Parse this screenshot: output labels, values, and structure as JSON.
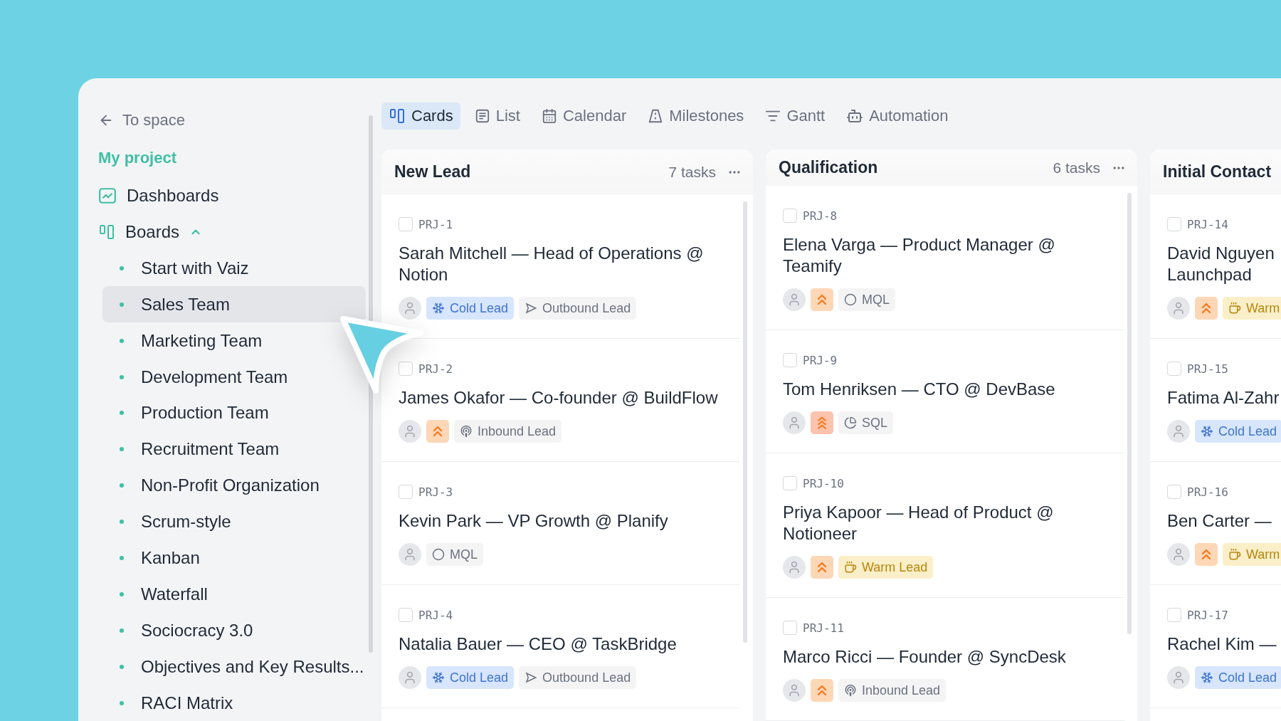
{
  "sidebar": {
    "back": "To space",
    "project": "My project",
    "nav": [
      {
        "kind": "dashboards",
        "label": "Dashboards"
      },
      {
        "kind": "boards",
        "label": "Boards",
        "expanded": true
      }
    ],
    "boards": [
      {
        "label": "Start with Vaiz",
        "selected": false
      },
      {
        "label": "Sales Team",
        "selected": true
      },
      {
        "label": "Marketing Team",
        "selected": false
      },
      {
        "label": "Development Team",
        "selected": false
      },
      {
        "label": "Production Team",
        "selected": false
      },
      {
        "label": "Recruitment Team",
        "selected": false
      },
      {
        "label": "Non-Profit Organization",
        "selected": false
      },
      {
        "label": "Scrum-style",
        "selected": false
      },
      {
        "label": "Kanban",
        "selected": false
      },
      {
        "label": "Waterfall",
        "selected": false
      },
      {
        "label": "Sociocracy 3.0",
        "selected": false
      },
      {
        "label": "Objectives and Key Results...",
        "selected": false
      },
      {
        "label": "RACI Matrix",
        "selected": false
      }
    ]
  },
  "tabs": [
    {
      "kind": "cards",
      "label": "Cards",
      "selected": true
    },
    {
      "kind": "list",
      "label": "List",
      "selected": false
    },
    {
      "kind": "calendar",
      "label": "Calendar",
      "selected": false
    },
    {
      "kind": "milestones",
      "label": "Milestones",
      "selected": false
    },
    {
      "kind": "gantt",
      "label": "Gantt",
      "selected": false
    },
    {
      "kind": "automation",
      "label": "Automation",
      "selected": false
    }
  ],
  "columns": [
    {
      "title": "New Lead",
      "count": "7 tasks",
      "scrollbar": true,
      "cards": [
        {
          "id": "PRJ-1",
          "checked": false,
          "title": "Sarah Mitchell — Head of Operations @ Notion",
          "tags": [
            {
              "kind": "cold",
              "label": "Cold Lead"
            },
            {
              "kind": "outbound",
              "label": "Outbound Lead"
            }
          ]
        },
        {
          "id": "PRJ-2",
          "checked": false,
          "title": "James Okafor — Co-founder @ BuildFlow",
          "priority": true,
          "urgent": false,
          "tags": [
            {
              "kind": "inbound",
              "label": "Inbound Lead"
            }
          ]
        },
        {
          "id": "PRJ-3",
          "checked": false,
          "title": "Kevin Park — VP Growth @ Planify",
          "tags": [
            {
              "kind": "mql",
              "label": "MQL"
            }
          ]
        },
        {
          "id": "PRJ-4",
          "checked": false,
          "title": "Natalia Bauer — CEO @ TaskBridge",
          "tags": [
            {
              "kind": "cold",
              "label": "Cold Lead"
            },
            {
              "kind": "outbound",
              "label": "Outbound Lead"
            }
          ]
        }
      ]
    },
    {
      "title": "Qualification",
      "count": "6 tasks",
      "scrollbar": true,
      "cards": [
        {
          "id": "PRJ-8",
          "checked": false,
          "title": "Elena Varga — Product Manager @ Teamify",
          "priority": true,
          "urgent": false,
          "tags": [
            {
              "kind": "mql",
              "label": "MQL"
            }
          ]
        },
        {
          "id": "PRJ-9",
          "checked": false,
          "title": "Tom Henriksen — CTO @ DevBase",
          "priority": true,
          "urgent": true,
          "tags": [
            {
              "kind": "sql",
              "label": "SQL"
            }
          ]
        },
        {
          "id": "PRJ-10",
          "checked": false,
          "title": "Priya Kapoor — Head of Product @ Notioneer",
          "priority": true,
          "urgent": false,
          "tags": [
            {
              "kind": "warm",
              "label": "Warm Lead"
            }
          ]
        },
        {
          "id": "PRJ-11",
          "checked": false,
          "title": "Marco Ricci — Founder @ SyncDesk",
          "priority": true,
          "urgent": false,
          "tags": [
            {
              "kind": "inbound",
              "label": "Inbound Lead"
            }
          ]
        }
      ]
    },
    {
      "title": "Initial Contact",
      "cards": [
        {
          "id": "PRJ-14",
          "checked": false,
          "title": "David Nguyen\nLaunchpad",
          "priority": true,
          "urgent": false,
          "tags": [
            {
              "kind": "warm",
              "label": "Warm"
            }
          ]
        },
        {
          "id": "PRJ-15",
          "checked": false,
          "title": "Fatima Al-Zahr",
          "tags": [
            {
              "kind": "cold",
              "label": "Cold Lead"
            }
          ]
        },
        {
          "id": "PRJ-16",
          "checked": false,
          "title": "Ben Carter —",
          "priority": true,
          "urgent": false,
          "tags": [
            {
              "kind": "warm",
              "label": "Warm"
            }
          ]
        },
        {
          "id": "PRJ-17",
          "checked": false,
          "title": "Rachel Kim —",
          "tags": [
            {
              "kind": "cold",
              "label": "Cold Lead"
            }
          ]
        }
      ]
    }
  ]
}
